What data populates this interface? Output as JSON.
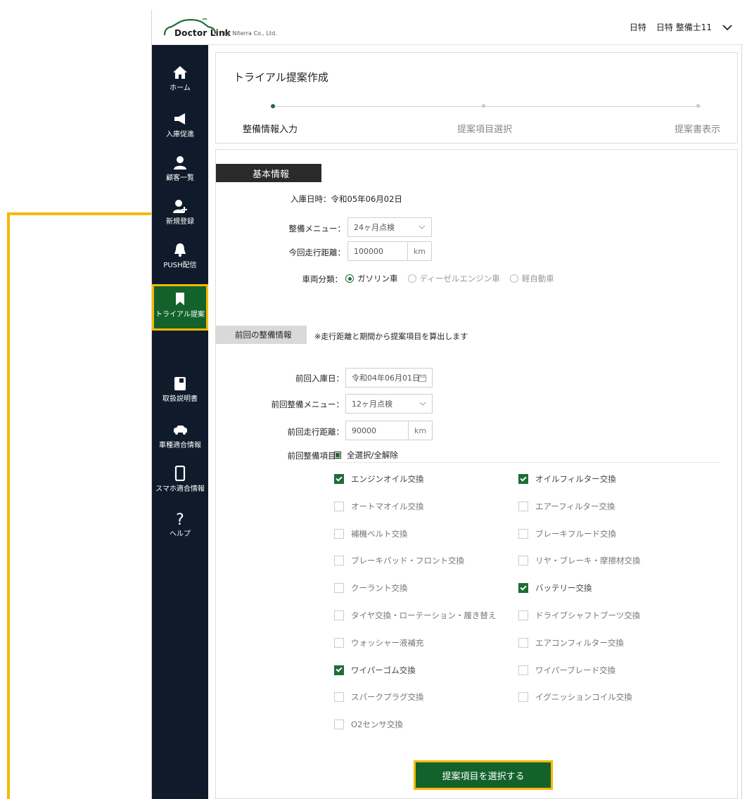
{
  "header": {
    "logo_text": "Doctor Link",
    "logo_by": "by Niterra Co., Ltd.",
    "user_company": "日特",
    "user_name": "日特 整備士11"
  },
  "sidebar": {
    "items": [
      {
        "label": "ホーム",
        "icon": "home-icon"
      },
      {
        "label": "入庫促進",
        "icon": "megaphone-icon"
      },
      {
        "label": "顧客一覧",
        "icon": "person-icon"
      },
      {
        "label": "新規登録",
        "icon": "person-add-icon"
      },
      {
        "label": "PUSH配信",
        "icon": "bell-icon"
      },
      {
        "label": "トライアル提案",
        "icon": "bookmark-icon"
      },
      {
        "label": "取扱説明書",
        "icon": "book-icon"
      },
      {
        "label": "車種適合情報",
        "icon": "car-icon"
      },
      {
        "label": "スマホ適合情報",
        "icon": "smartphone-icon"
      },
      {
        "label": "ヘルプ",
        "icon": "question-icon"
      }
    ],
    "active": "トライアル提案"
  },
  "page": {
    "title": "トライアル提案作成",
    "steps": [
      "整備情報入力",
      "提案項目選択",
      "提案書表示"
    ],
    "current_step": 1
  },
  "basic": {
    "heading": "基本情報",
    "entry_date_label": "入庫日時：",
    "entry_date": "令和05年06月02日",
    "menu_label": "整備メニュー：",
    "menu_value": "24ヶ月点検",
    "mileage_label": "今回走行距離：",
    "mileage_value": "100000",
    "mileage_unit": "km",
    "vehicle_type_label": "車両分類：",
    "vehicle_types": [
      "ガソリン車",
      "ディーゼルエンジン車",
      "軽自動車"
    ],
    "vehicle_type_selected": "ガソリン車"
  },
  "previous": {
    "heading": "前回の整備情報",
    "note": "※走行距離と期間から提案項目を算出します",
    "date_label": "前回入庫日：",
    "date_value": "令和04年06月01日",
    "menu_label": "前回整備メニュー：",
    "menu_value": "12ヶ月点検",
    "mileage_label": "前回走行距離：",
    "mileage_value": "90000",
    "mileage_unit": "km",
    "items_label": "前回整備項目：",
    "select_all": "全選択/全解除",
    "items": [
      {
        "label": "エンジンオイル交換",
        "checked": true
      },
      {
        "label": "オイルフィルター交換",
        "checked": true
      },
      {
        "label": "オートマオイル交換",
        "checked": false
      },
      {
        "label": "エアーフィルター交換",
        "checked": false
      },
      {
        "label": "補機ベルト交換",
        "checked": false
      },
      {
        "label": "ブレーキフルード交換",
        "checked": false
      },
      {
        "label": "ブレーキパッド・フロント交換",
        "checked": false
      },
      {
        "label": "リヤ・ブレーキ・摩擦材交換",
        "checked": false
      },
      {
        "label": "クーラント交換",
        "checked": false
      },
      {
        "label": "バッテリー交換",
        "checked": true
      },
      {
        "label": "タイヤ交換・ローテーション・履き替え",
        "checked": false
      },
      {
        "label": "ドライブシャフトブーツ交換",
        "checked": false
      },
      {
        "label": "ウォッシャー液補充",
        "checked": false
      },
      {
        "label": "エアコンフィルター交換",
        "checked": false
      },
      {
        "label": "ワイパーゴム交換",
        "checked": true
      },
      {
        "label": "ワイパーブレード交換",
        "checked": false
      },
      {
        "label": "スパークプラグ交換",
        "checked": false
      },
      {
        "label": "イグニッションコイル交換",
        "checked": false
      },
      {
        "label": "O2センサ交換",
        "checked": false
      }
    ]
  },
  "actions": {
    "submit_label": "提案項目を選択する"
  },
  "colors": {
    "brand_green": "#13622c",
    "sidebar_bg": "#0f1b2b",
    "annotation": "#f5b800"
  }
}
